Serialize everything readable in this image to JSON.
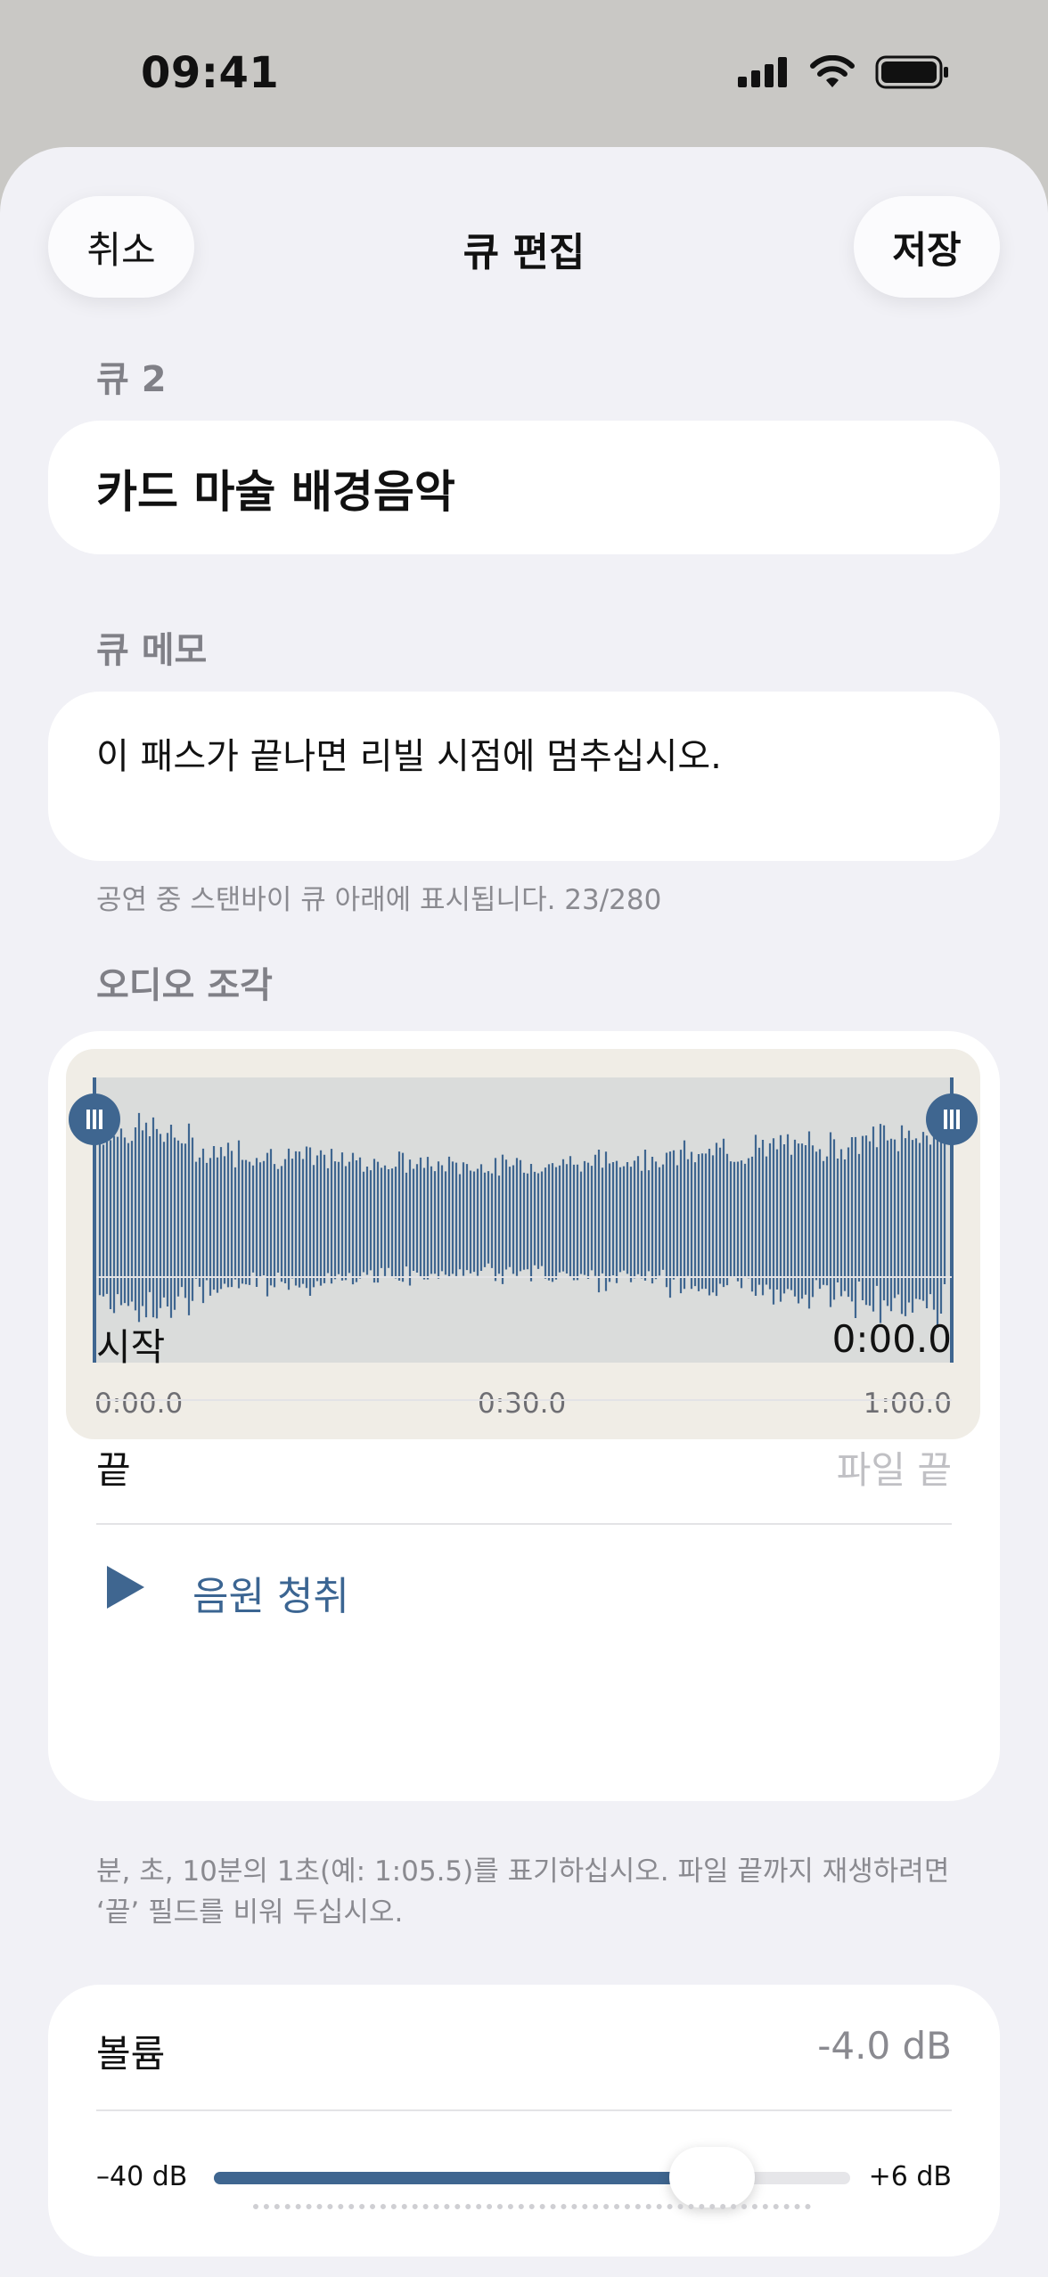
{
  "status_bar": {
    "time": "09:41",
    "icons": [
      "signal-icon",
      "wifi-icon",
      "battery-icon"
    ]
  },
  "nav": {
    "cancel": "취소",
    "title": "큐 편집",
    "save": "저장"
  },
  "cue": {
    "label": "큐 2",
    "name": "카드 마술 배경음악"
  },
  "memo": {
    "label": "큐 메모",
    "text": "이 패스가 끝나면 리빌 시점에 멈추십시오.",
    "helper": "공연 중 스탠바이 큐 아래에 표시됩니다. 23/280"
  },
  "audio": {
    "label": "오디오 조각",
    "waveform_times": [
      "0:00.0",
      "0:30.0",
      "1:00.0"
    ],
    "start_label": "시작",
    "start_value": "0:00.0",
    "end_label": "끝",
    "end_placeholder": "파일 끝",
    "preview_label": "음원 청취",
    "helper": "분, 초, 10분의 1초(예: 1:05.5)를 표기하십시오. 파일 끝까지 재생하려면 ‘끝’ 필드를 비워 두십시오."
  },
  "volume": {
    "label": "볼륨",
    "value": "-4.0 dB",
    "min_label": "–40 dB",
    "max_label": "+6 dB",
    "level_fraction": 0.783
  },
  "colors": {
    "accent": "#3f6690",
    "sheet_bg": "#f1f1f6"
  }
}
